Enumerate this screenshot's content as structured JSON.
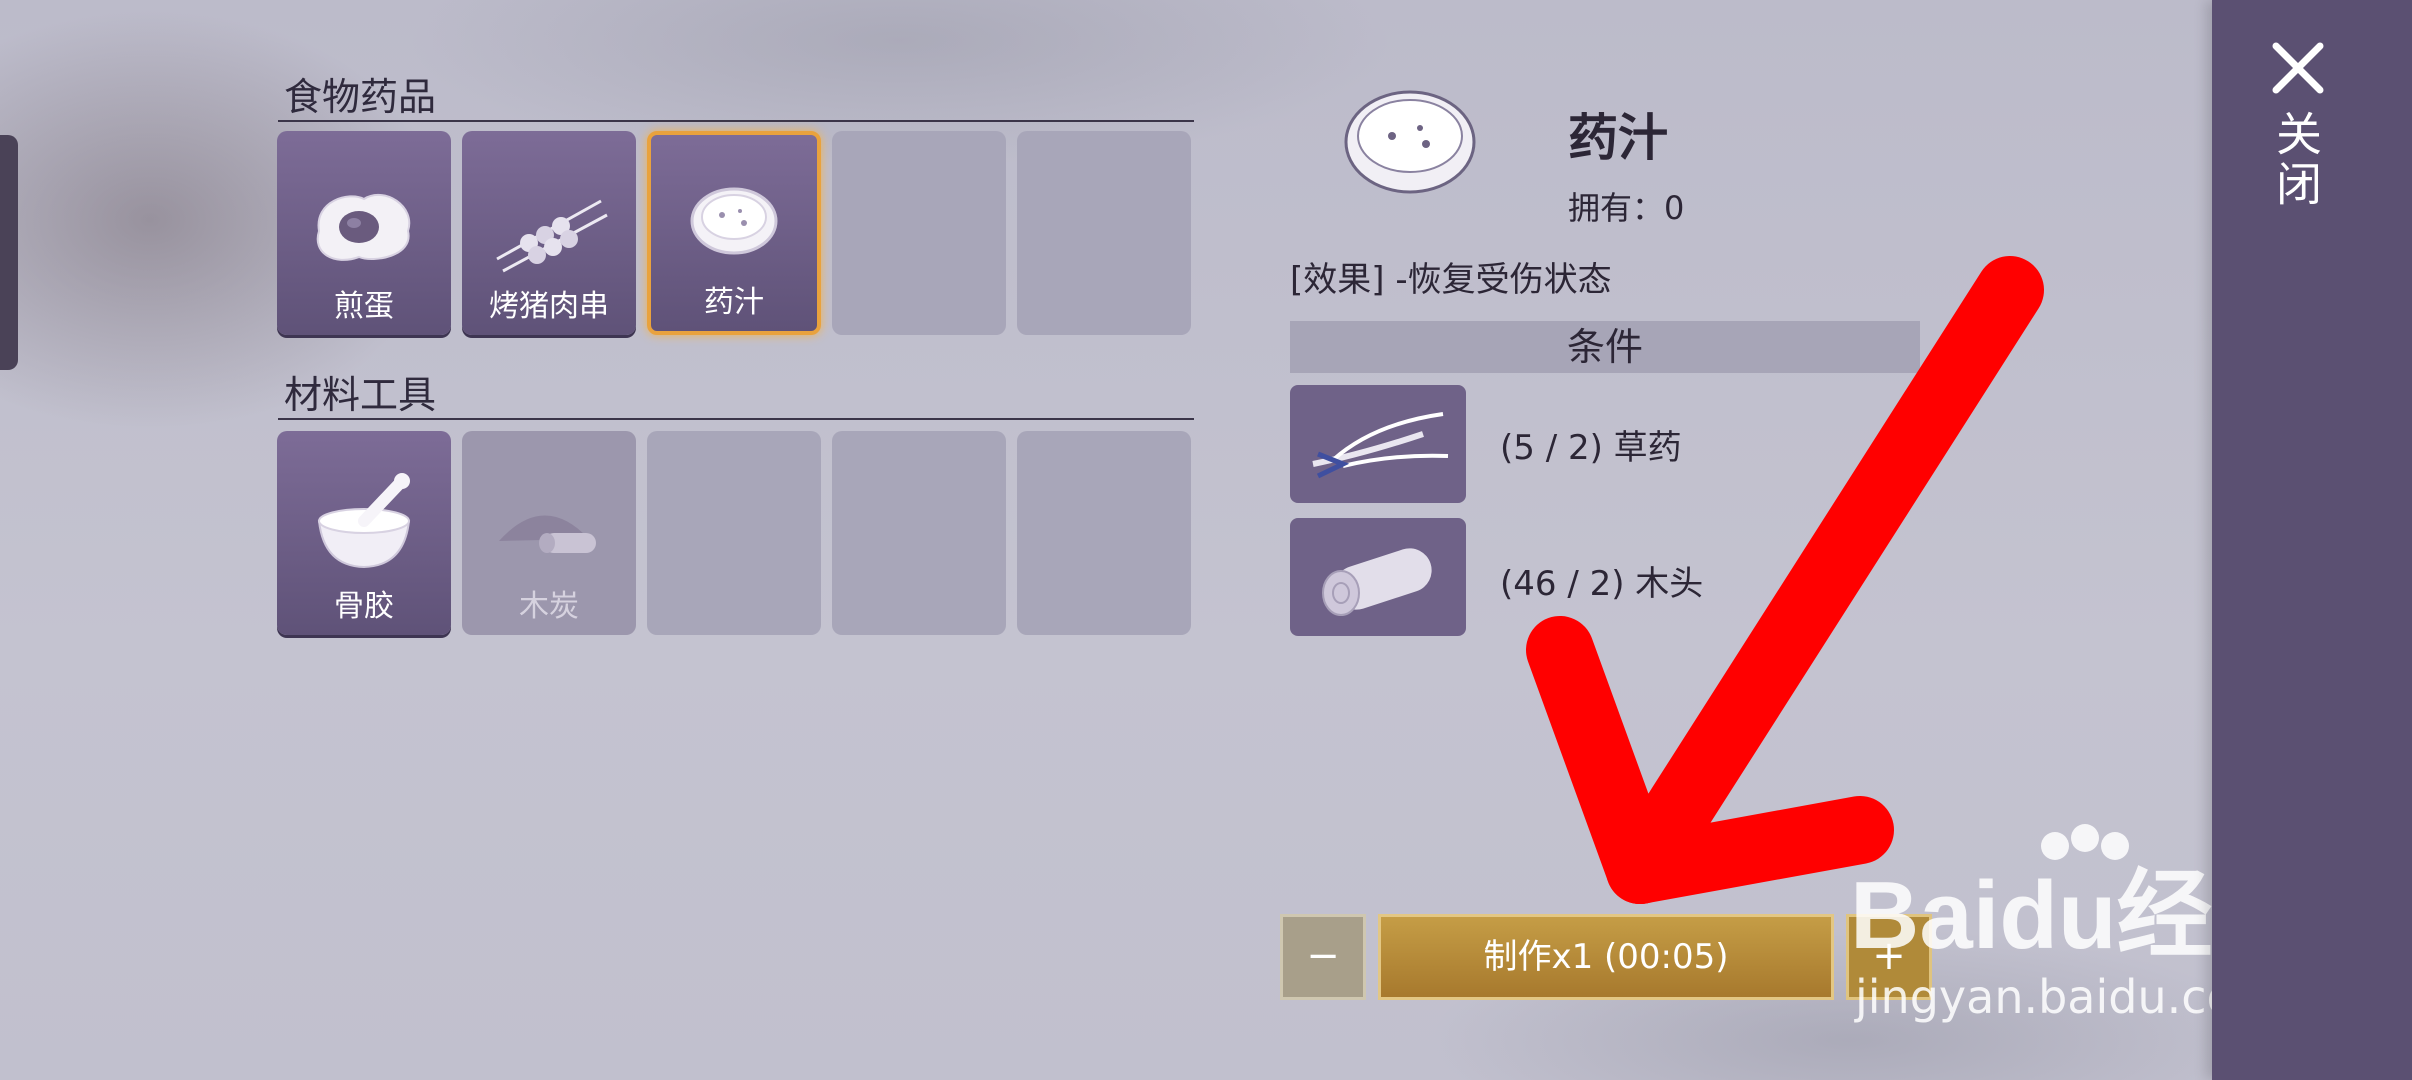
{
  "close": {
    "label": "关闭"
  },
  "categories": [
    {
      "title": "食物药品",
      "items": [
        {
          "label": "煎蛋",
          "icon": "fried-egg-icon",
          "state": "filled"
        },
        {
          "label": "烤猪肉串",
          "icon": "pork-skewer-icon",
          "state": "filled"
        },
        {
          "label": "药汁",
          "icon": "herbal-soup-bowl-icon",
          "state": "selected"
        },
        {
          "label": "",
          "state": "empty"
        },
        {
          "label": "",
          "state": "empty"
        }
      ]
    },
    {
      "title": "材料工具",
      "items": [
        {
          "label": "骨胶",
          "icon": "bone-glue-mortar-icon",
          "state": "filled"
        },
        {
          "label": "木炭",
          "icon": "charcoal-icon",
          "state": "faded"
        },
        {
          "label": "",
          "state": "empty"
        },
        {
          "label": "",
          "state": "empty"
        },
        {
          "label": "",
          "state": "empty"
        }
      ]
    }
  ],
  "detail": {
    "name": "药汁",
    "owned_label": "拥有：",
    "owned_value": "0",
    "effect": "[效果] -恢复受伤状态",
    "conditions_header": "条件",
    "conditions": [
      {
        "text": "(5 / 2) 草药",
        "icon": "herb-icon"
      },
      {
        "text": "(46 / 2) 木头",
        "icon": "wood-log-icon"
      }
    ]
  },
  "craft": {
    "minus": "−",
    "make_label": "制作x1 (00:05)",
    "plus": "+"
  },
  "watermark": {
    "main": "Baidu经验",
    "sub": "jingyan.baidu.com"
  },
  "colors": {
    "accent_gold": "#c59d46",
    "slot_purple": "#6f6288",
    "selected_border": "#e9a23d",
    "annotation_red": "#ff0000"
  }
}
